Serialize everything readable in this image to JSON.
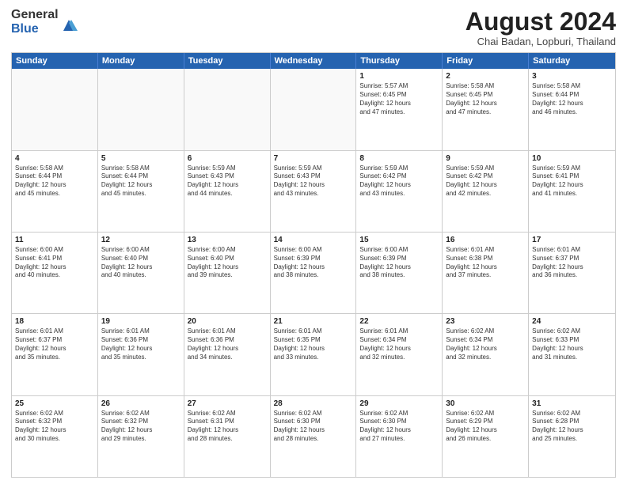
{
  "logo": {
    "general": "General",
    "blue": "Blue"
  },
  "title": "August 2024",
  "location": "Chai Badan, Lopburi, Thailand",
  "days_of_week": [
    "Sunday",
    "Monday",
    "Tuesday",
    "Wednesday",
    "Thursday",
    "Friday",
    "Saturday"
  ],
  "weeks": [
    [
      {
        "day": "",
        "info": "",
        "empty": true
      },
      {
        "day": "",
        "info": "",
        "empty": true
      },
      {
        "day": "",
        "info": "",
        "empty": true
      },
      {
        "day": "",
        "info": "",
        "empty": true
      },
      {
        "day": "1",
        "info": "Sunrise: 5:57 AM\nSunset: 6:45 PM\nDaylight: 12 hours\nand 47 minutes."
      },
      {
        "day": "2",
        "info": "Sunrise: 5:58 AM\nSunset: 6:45 PM\nDaylight: 12 hours\nand 47 minutes."
      },
      {
        "day": "3",
        "info": "Sunrise: 5:58 AM\nSunset: 6:44 PM\nDaylight: 12 hours\nand 46 minutes."
      }
    ],
    [
      {
        "day": "4",
        "info": "Sunrise: 5:58 AM\nSunset: 6:44 PM\nDaylight: 12 hours\nand 45 minutes."
      },
      {
        "day": "5",
        "info": "Sunrise: 5:58 AM\nSunset: 6:44 PM\nDaylight: 12 hours\nand 45 minutes."
      },
      {
        "day": "6",
        "info": "Sunrise: 5:59 AM\nSunset: 6:43 PM\nDaylight: 12 hours\nand 44 minutes."
      },
      {
        "day": "7",
        "info": "Sunrise: 5:59 AM\nSunset: 6:43 PM\nDaylight: 12 hours\nand 43 minutes."
      },
      {
        "day": "8",
        "info": "Sunrise: 5:59 AM\nSunset: 6:42 PM\nDaylight: 12 hours\nand 43 minutes."
      },
      {
        "day": "9",
        "info": "Sunrise: 5:59 AM\nSunset: 6:42 PM\nDaylight: 12 hours\nand 42 minutes."
      },
      {
        "day": "10",
        "info": "Sunrise: 5:59 AM\nSunset: 6:41 PM\nDaylight: 12 hours\nand 41 minutes."
      }
    ],
    [
      {
        "day": "11",
        "info": "Sunrise: 6:00 AM\nSunset: 6:41 PM\nDaylight: 12 hours\nand 40 minutes."
      },
      {
        "day": "12",
        "info": "Sunrise: 6:00 AM\nSunset: 6:40 PM\nDaylight: 12 hours\nand 40 minutes."
      },
      {
        "day": "13",
        "info": "Sunrise: 6:00 AM\nSunset: 6:40 PM\nDaylight: 12 hours\nand 39 minutes."
      },
      {
        "day": "14",
        "info": "Sunrise: 6:00 AM\nSunset: 6:39 PM\nDaylight: 12 hours\nand 38 minutes."
      },
      {
        "day": "15",
        "info": "Sunrise: 6:00 AM\nSunset: 6:39 PM\nDaylight: 12 hours\nand 38 minutes."
      },
      {
        "day": "16",
        "info": "Sunrise: 6:01 AM\nSunset: 6:38 PM\nDaylight: 12 hours\nand 37 minutes."
      },
      {
        "day": "17",
        "info": "Sunrise: 6:01 AM\nSunset: 6:37 PM\nDaylight: 12 hours\nand 36 minutes."
      }
    ],
    [
      {
        "day": "18",
        "info": "Sunrise: 6:01 AM\nSunset: 6:37 PM\nDaylight: 12 hours\nand 35 minutes."
      },
      {
        "day": "19",
        "info": "Sunrise: 6:01 AM\nSunset: 6:36 PM\nDaylight: 12 hours\nand 35 minutes."
      },
      {
        "day": "20",
        "info": "Sunrise: 6:01 AM\nSunset: 6:36 PM\nDaylight: 12 hours\nand 34 minutes."
      },
      {
        "day": "21",
        "info": "Sunrise: 6:01 AM\nSunset: 6:35 PM\nDaylight: 12 hours\nand 33 minutes."
      },
      {
        "day": "22",
        "info": "Sunrise: 6:01 AM\nSunset: 6:34 PM\nDaylight: 12 hours\nand 32 minutes."
      },
      {
        "day": "23",
        "info": "Sunrise: 6:02 AM\nSunset: 6:34 PM\nDaylight: 12 hours\nand 32 minutes."
      },
      {
        "day": "24",
        "info": "Sunrise: 6:02 AM\nSunset: 6:33 PM\nDaylight: 12 hours\nand 31 minutes."
      }
    ],
    [
      {
        "day": "25",
        "info": "Sunrise: 6:02 AM\nSunset: 6:32 PM\nDaylight: 12 hours\nand 30 minutes."
      },
      {
        "day": "26",
        "info": "Sunrise: 6:02 AM\nSunset: 6:32 PM\nDaylight: 12 hours\nand 29 minutes."
      },
      {
        "day": "27",
        "info": "Sunrise: 6:02 AM\nSunset: 6:31 PM\nDaylight: 12 hours\nand 28 minutes."
      },
      {
        "day": "28",
        "info": "Sunrise: 6:02 AM\nSunset: 6:30 PM\nDaylight: 12 hours\nand 28 minutes."
      },
      {
        "day": "29",
        "info": "Sunrise: 6:02 AM\nSunset: 6:30 PM\nDaylight: 12 hours\nand 27 minutes."
      },
      {
        "day": "30",
        "info": "Sunrise: 6:02 AM\nSunset: 6:29 PM\nDaylight: 12 hours\nand 26 minutes."
      },
      {
        "day": "31",
        "info": "Sunrise: 6:02 AM\nSunset: 6:28 PM\nDaylight: 12 hours\nand 25 minutes."
      }
    ]
  ]
}
